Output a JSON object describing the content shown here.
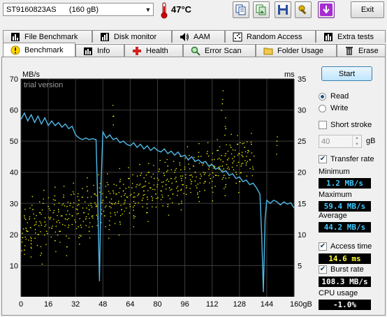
{
  "toolbar": {
    "drive_name": "ST9160823AS",
    "drive_size": "(160 gB)",
    "temperature": "47°C",
    "exit_label": "Exit"
  },
  "tabs_row1": [
    {
      "label": "File Benchmark",
      "icon": "file-benchmark-icon"
    },
    {
      "label": "Disk monitor",
      "icon": "disk-monitor-icon"
    },
    {
      "label": "AAM",
      "icon": "speaker-icon"
    },
    {
      "label": "Random Access",
      "icon": "random-access-icon"
    },
    {
      "label": "Extra tests",
      "icon": "extra-tests-icon"
    }
  ],
  "tabs_row2": [
    {
      "label": "Benchmark",
      "icon": "benchmark-icon",
      "active": true
    },
    {
      "label": "Info",
      "icon": "info-icon"
    },
    {
      "label": "Health",
      "icon": "health-cross-icon"
    },
    {
      "label": "Error Scan",
      "icon": "magnifier-icon"
    },
    {
      "label": "Folder Usage",
      "icon": "folder-icon"
    },
    {
      "label": "Erase",
      "icon": "trash-icon"
    }
  ],
  "controls": {
    "start_label": "Start",
    "read_label": "Read",
    "write_label": "Write",
    "mode": "read",
    "short_stroke_label": "Short stroke",
    "short_stroke_checked": false,
    "short_stroke_value": "40",
    "short_stroke_unit": "gB",
    "transfer_rate_label": "Transfer rate",
    "transfer_rate_checked": true,
    "minimum_label": "Minimum",
    "minimum_value": "1.2 MB/s",
    "maximum_label": "Maximum",
    "maximum_value": "59.4 MB/s",
    "average_label": "Average",
    "average_value": "44.2 MB/s",
    "access_time_label": "Access time",
    "access_time_checked": true,
    "access_time_value": "14.6 ms",
    "burst_rate_label": "Burst rate",
    "burst_rate_checked": true,
    "burst_rate_value": "108.3 MB/s",
    "cpu_usage_label": "CPU usage",
    "cpu_usage_value": "-1.0%"
  },
  "chart_data": {
    "type": "line",
    "watermark": "trial version",
    "x_unit_label": "gB",
    "left_unit": "MB/s",
    "right_unit": "ms",
    "xlim": [
      0,
      160
    ],
    "ylim_left": [
      0,
      70
    ],
    "ylim_right": [
      0,
      35
    ],
    "x_ticks": [
      0,
      16,
      32,
      48,
      64,
      80,
      96,
      112,
      128,
      144,
      160
    ],
    "y_left_ticks": [
      10,
      20,
      30,
      40,
      50,
      60,
      70
    ],
    "y_right_ticks": [
      5,
      10,
      15,
      20,
      25,
      30,
      35
    ],
    "grid": true,
    "background": "#000000",
    "series": [
      {
        "unit": "MB/s",
        "color": "#4fb9e8",
        "points": [
          [
            0,
            57.0
          ],
          [
            2,
            59.0
          ],
          [
            4,
            56.5
          ],
          [
            6,
            58.5
          ],
          [
            8,
            56.0
          ],
          [
            10,
            58.0
          ],
          [
            12,
            55.5
          ],
          [
            14,
            57.5
          ],
          [
            16,
            55.0
          ],
          [
            18,
            56.5
          ],
          [
            20,
            55.0
          ],
          [
            22,
            56.0
          ],
          [
            24,
            54.5
          ],
          [
            26,
            55.5
          ],
          [
            28,
            54.0
          ],
          [
            30,
            54.8
          ],
          [
            32,
            52.0
          ],
          [
            34,
            51.0
          ],
          [
            36,
            50.5
          ],
          [
            38,
            51.0
          ],
          [
            40,
            50.5
          ],
          [
            42,
            50.8
          ],
          [
            44,
            50.5
          ],
          [
            45,
            30.0
          ],
          [
            46,
            5.0
          ],
          [
            47,
            38.0
          ],
          [
            48,
            53.0
          ],
          [
            50,
            51.0
          ],
          [
            52,
            52.0
          ],
          [
            54,
            50.5
          ],
          [
            56,
            51.0
          ],
          [
            58,
            49.5
          ],
          [
            60,
            50.0
          ],
          [
            62,
            49.0
          ],
          [
            64,
            48.5
          ],
          [
            66,
            49.5
          ],
          [
            68,
            48.0
          ],
          [
            70,
            49.0
          ],
          [
            72,
            47.5
          ],
          [
            74,
            48.5
          ],
          [
            76,
            47.0
          ],
          [
            78,
            48.0
          ],
          [
            80,
            47.0
          ],
          [
            82,
            46.5
          ],
          [
            84,
            47.5
          ],
          [
            86,
            46.0
          ],
          [
            88,
            46.8
          ],
          [
            90,
            45.5
          ],
          [
            92,
            46.5
          ],
          [
            94,
            45.0
          ],
          [
            96,
            45.5
          ],
          [
            98,
            44.0
          ],
          [
            100,
            45.0
          ],
          [
            102,
            43.5
          ],
          [
            104,
            44.0
          ],
          [
            106,
            43.0
          ],
          [
            108,
            43.5
          ],
          [
            110,
            42.0
          ],
          [
            112,
            42.5
          ],
          [
            114,
            41.0
          ],
          [
            116,
            41.5
          ],
          [
            118,
            40.0
          ],
          [
            120,
            40.5
          ],
          [
            122,
            39.0
          ],
          [
            124,
            39.5
          ],
          [
            126,
            38.0
          ],
          [
            128,
            38.5
          ],
          [
            130,
            37.0
          ],
          [
            132,
            37.5
          ],
          [
            134,
            36.0
          ],
          [
            136,
            36.5
          ],
          [
            138,
            35.0
          ],
          [
            140,
            33.0
          ],
          [
            141,
            20.0
          ],
          [
            142,
            1.5
          ],
          [
            143,
            25.0
          ],
          [
            144,
            31.0
          ],
          [
            146,
            30.0
          ],
          [
            148,
            31.0
          ],
          [
            150,
            30.5
          ],
          [
            152,
            29.5
          ],
          [
            154,
            30.5
          ],
          [
            156,
            29.8
          ],
          [
            158,
            30.2
          ],
          [
            160,
            28.5
          ]
        ]
      },
      {
        "unit": "ms",
        "color": "#e6e600",
        "points": [
          [
            1,
            9.5
          ],
          [
            2,
            13.0
          ],
          [
            3,
            11.0
          ],
          [
            4,
            10.5
          ],
          [
            5,
            12.5
          ],
          [
            6,
            9.0
          ],
          [
            7,
            14.0
          ],
          [
            8,
            11.5
          ],
          [
            9,
            12.0
          ],
          [
            10,
            10.0
          ],
          [
            11,
            13.5
          ],
          [
            12,
            11.5
          ],
          [
            13,
            15.0
          ],
          [
            14,
            12.0
          ],
          [
            15,
            10.5
          ],
          [
            16,
            14.5
          ],
          [
            17,
            12.5
          ],
          [
            18,
            11.0
          ],
          [
            19,
            13.5
          ],
          [
            20,
            15.5
          ],
          [
            21,
            12.0
          ],
          [
            22,
            14.0
          ],
          [
            23,
            10.5
          ],
          [
            24,
            13.0
          ],
          [
            25,
            16.0
          ],
          [
            26,
            12.5
          ],
          [
            27,
            14.5
          ],
          [
            28,
            11.5
          ],
          [
            29,
            15.0
          ],
          [
            30,
            13.0
          ],
          [
            31,
            16.5
          ],
          [
            32,
            12.0
          ],
          [
            33,
            14.0
          ],
          [
            34,
            15.5
          ],
          [
            35,
            11.5
          ],
          [
            36,
            16.0
          ],
          [
            37,
            13.5
          ],
          [
            38,
            12.5
          ],
          [
            39,
            17.0
          ],
          [
            40,
            14.0
          ],
          [
            41,
            15.0
          ],
          [
            42,
            13.0
          ],
          [
            43,
            16.5
          ],
          [
            44,
            14.5
          ],
          [
            45,
            12.5
          ],
          [
            46,
            17.5
          ],
          [
            47,
            14.0
          ],
          [
            48,
            15.5
          ],
          [
            49,
            13.0
          ],
          [
            50,
            16.0
          ],
          [
            51,
            18.0
          ],
          [
            52,
            14.5
          ],
          [
            53,
            15.0
          ],
          [
            54,
            17.0
          ],
          [
            55,
            13.5
          ],
          [
            56,
            16.5
          ],
          [
            57,
            15.0
          ],
          [
            58,
            18.5
          ],
          [
            59,
            14.0
          ],
          [
            60,
            17.0
          ],
          [
            61,
            15.5
          ],
          [
            62,
            16.0
          ],
          [
            63,
            19.0
          ],
          [
            64,
            14.5
          ],
          [
            65,
            17.5
          ],
          [
            66,
            16.0
          ],
          [
            67,
            15.0
          ],
          [
            68,
            18.0
          ],
          [
            69,
            16.5
          ],
          [
            70,
            19.5
          ],
          [
            71,
            15.5
          ],
          [
            72,
            17.0
          ],
          [
            73,
            18.5
          ],
          [
            74,
            16.0
          ],
          [
            75,
            20.0
          ],
          [
            76,
            17.5
          ],
          [
            77,
            15.5
          ],
          [
            78,
            19.0
          ],
          [
            79,
            16.5
          ],
          [
            80,
            18.0
          ],
          [
            81,
            20.5
          ],
          [
            82,
            17.0
          ],
          [
            83,
            16.0
          ],
          [
            84,
            19.5
          ],
          [
            85,
            18.0
          ],
          [
            86,
            21.0
          ],
          [
            87,
            17.5
          ],
          [
            88,
            19.0
          ],
          [
            89,
            16.5
          ],
          [
            90,
            20.0
          ],
          [
            91,
            18.5
          ],
          [
            92,
            17.0
          ],
          [
            93,
            21.5
          ],
          [
            94,
            19.0
          ],
          [
            95,
            18.0
          ],
          [
            96,
            20.5
          ],
          [
            97,
            17.5
          ],
          [
            98,
            22.0
          ],
          [
            99,
            19.5
          ],
          [
            100,
            18.5
          ],
          [
            101,
            21.0
          ],
          [
            102,
            20.0
          ],
          [
            103,
            17.5
          ],
          [
            104,
            22.5
          ],
          [
            105,
            19.0
          ],
          [
            106,
            21.5
          ],
          [
            107,
            20.0
          ],
          [
            108,
            18.5
          ],
          [
            109,
            23.0
          ],
          [
            110,
            20.5
          ],
          [
            111,
            19.0
          ],
          [
            112,
            22.0
          ],
          [
            113,
            21.0
          ],
          [
            114,
            19.5
          ],
          [
            115,
            23.5
          ],
          [
            116,
            20.5
          ],
          [
            117,
            22.0
          ],
          [
            118,
            21.0
          ],
          [
            119,
            19.5
          ],
          [
            120,
            23.0
          ],
          [
            121,
            22.0
          ],
          [
            122,
            20.5
          ],
          [
            123,
            24.0
          ],
          [
            124,
            21.5
          ],
          [
            125,
            22.5
          ],
          [
            126,
            20.0
          ],
          [
            127,
            24.5
          ],
          [
            128,
            23.0
          ],
          [
            129,
            21.0
          ],
          [
            130,
            22.5
          ],
          [
            131,
            24.0
          ],
          [
            132,
            21.5
          ],
          [
            133,
            23.5
          ],
          [
            134,
            22.0
          ],
          [
            135,
            24.5
          ],
          [
            136,
            20.5
          ],
          [
            2,
            7.5
          ],
          [
            6,
            8.5
          ],
          [
            12,
            7.0
          ],
          [
            20,
            9.0
          ],
          [
            27,
            8.0
          ],
          [
            34,
            9.5
          ],
          [
            40,
            10.5
          ],
          [
            52,
            11.5
          ],
          [
            58,
            12.0
          ],
          [
            66,
            13.0
          ],
          [
            74,
            13.5
          ],
          [
            86,
            14.5
          ],
          [
            94,
            15.0
          ],
          [
            104,
            16.0
          ],
          [
            112,
            17.5
          ],
          [
            120,
            18.0
          ],
          [
            128,
            18.5
          ],
          [
            54,
            29.0
          ],
          [
            120,
            27.0
          ],
          [
            118,
            31.0
          ],
          [
            150,
            25.0
          ]
        ]
      }
    ]
  }
}
